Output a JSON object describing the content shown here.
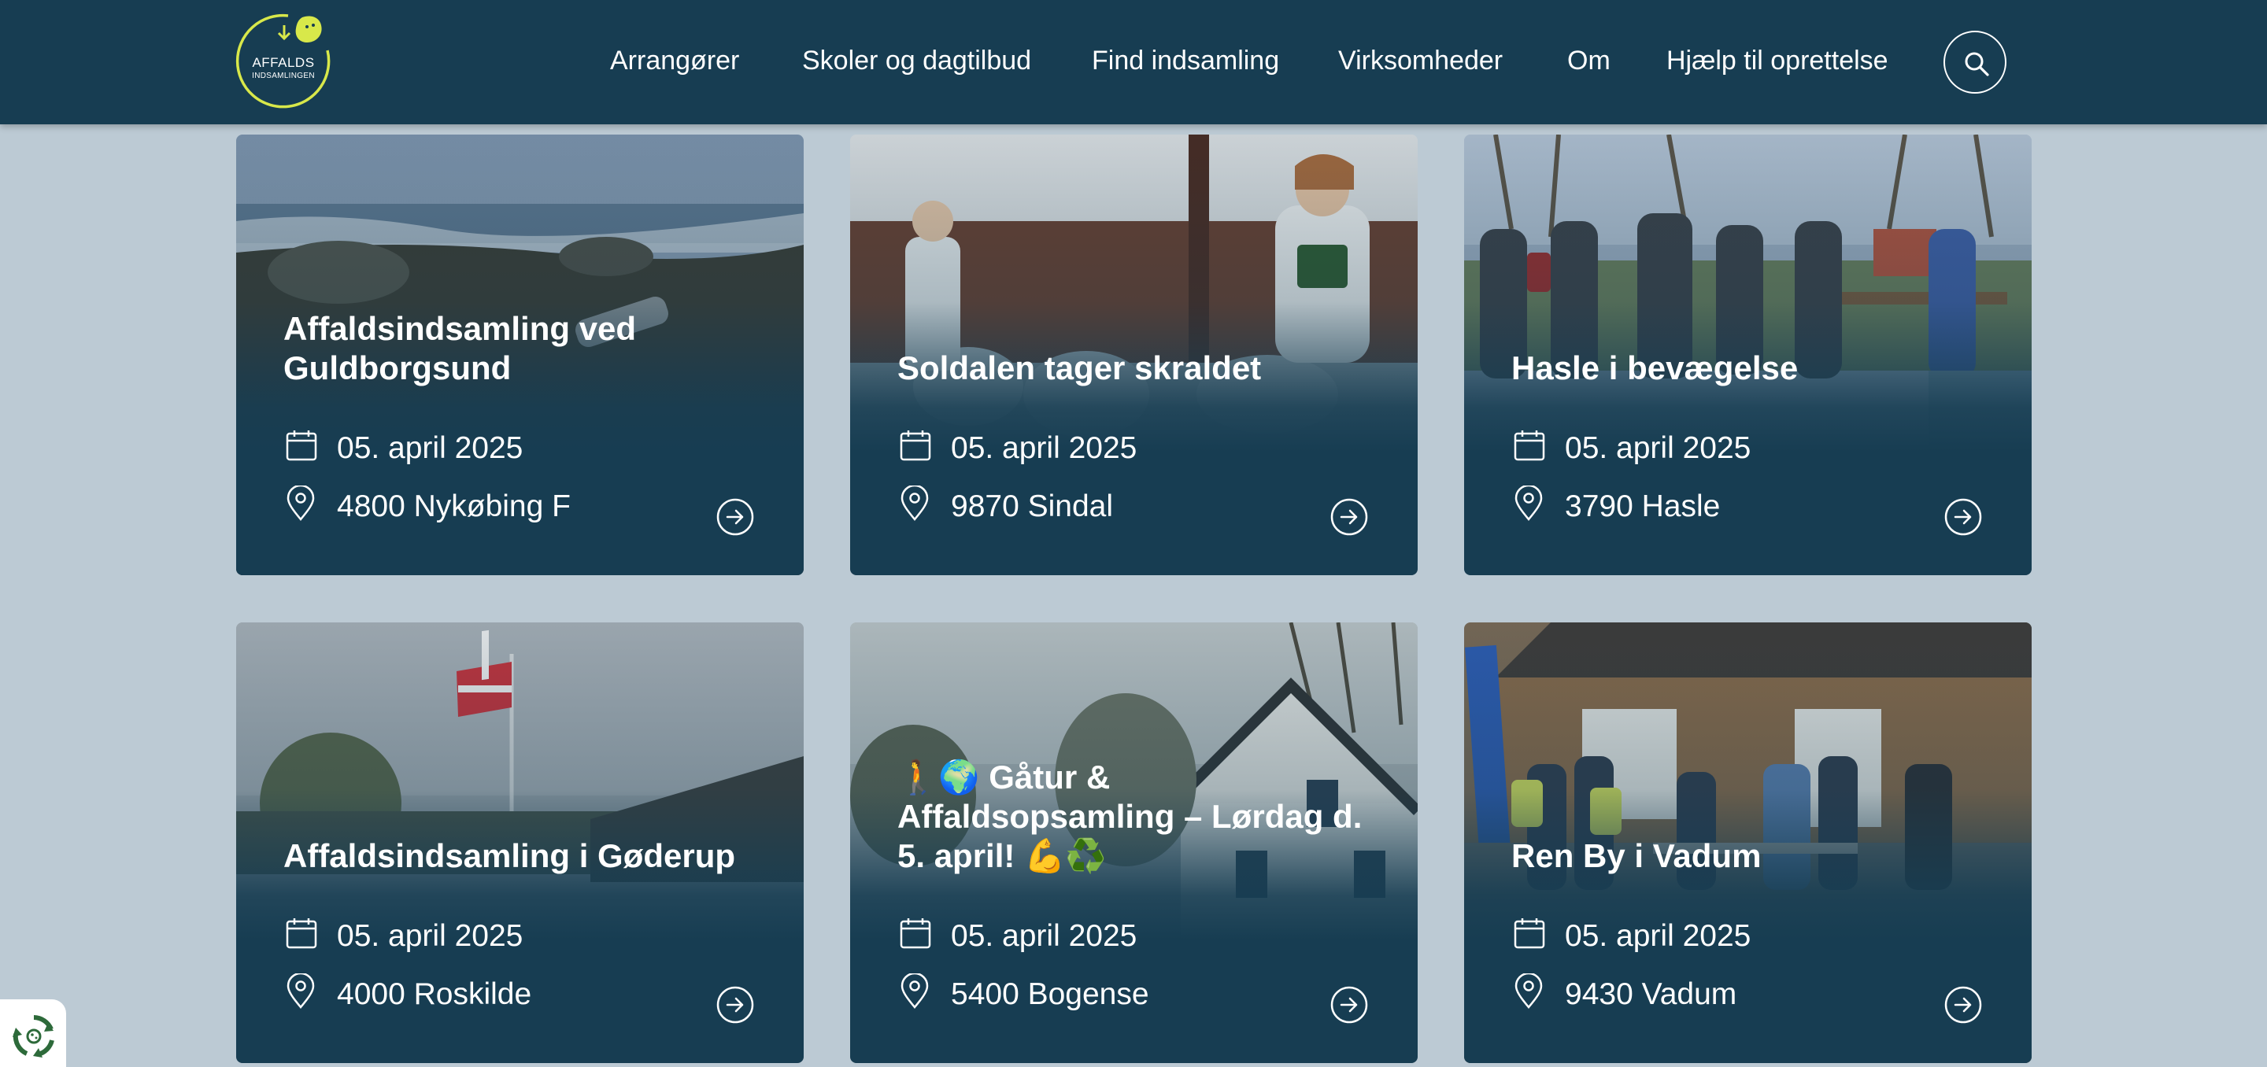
{
  "brand": {
    "logo_line1": "AFFALDS",
    "logo_line2": "INDSAMLINGEN",
    "logo_ring_color": "#d8e84a",
    "logo_blob_color": "#d8e84a"
  },
  "nav": {
    "items": [
      "Arrangører",
      "Skoler og dagtilbud",
      "Find indsamling",
      "Virksomheder",
      "Om",
      "Hjælp til oprettelse"
    ],
    "search_icon": "search-icon"
  },
  "colors": {
    "header_bg": "#173d52",
    "page_bg": "#bccad4",
    "card_bg": "#173d52",
    "text": "#ffffff"
  },
  "events": [
    {
      "title": "Affaldsindsamling ved Guldborgsund",
      "date": "05. april 2025",
      "location": "4800 Nykøbing F",
      "photo": "beach-stones-can"
    },
    {
      "title": "Soldalen tager skraldet",
      "date": "05. april 2025",
      "location": "9870 Sindal",
      "photo": "kids-with-trash-bags"
    },
    {
      "title": "Hasle i bevægelse",
      "date": "05. april 2025",
      "location": "3790 Hasle",
      "photo": "group-of-volunteers"
    },
    {
      "title": "Affaldsindsamling i Gøderup",
      "date": "05. april 2025",
      "location": "4000 Roskilde",
      "photo": "danish-flag-pole"
    },
    {
      "title": "🚶🌍 Gåtur & Affaldsopsamling – Lørdag d. 5. april! 💪♻️",
      "date": "05. april 2025",
      "location": "5400 Bogense",
      "photo": "white-house-trees"
    },
    {
      "title": "Ren By i Vadum",
      "date": "05. april 2025",
      "location": "9430 Vadum",
      "photo": "volunteers-by-house"
    }
  ],
  "icons": {
    "date": "calendar-icon",
    "location": "map-pin-icon",
    "open": "arrow-circle-right-icon",
    "widget": "recycle-icon"
  }
}
